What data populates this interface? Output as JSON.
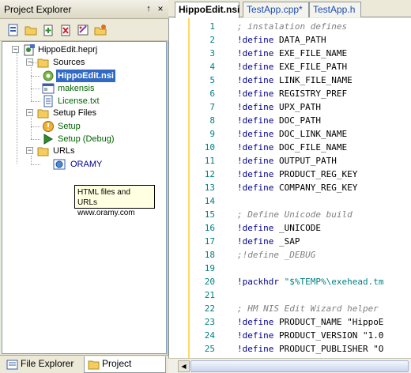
{
  "panel": {
    "title": "Project Explorer",
    "pin_glyph": "↑",
    "close_glyph": "×"
  },
  "toolbar": {
    "buttons": [
      "new-project-icon",
      "open-project-icon",
      "add-file-icon",
      "remove-icon",
      "properties-icon",
      "folder-settings-icon"
    ]
  },
  "tree": {
    "root": "HippoEdit.heprj",
    "sources_label": "Sources",
    "sources": [
      "HippoEdit.nsi",
      "makensis",
      "License.txt"
    ],
    "setup_label": "Setup Files",
    "setup": [
      "Setup",
      "Setup (Debug)"
    ],
    "urls_label": "URLs",
    "urls": [
      "ORAMY"
    ]
  },
  "tooltip": {
    "line1": "HTML files and URLs",
    "line2": "www.oramy.com"
  },
  "bottom_tabs": [
    "File Explorer",
    "Project Explo..."
  ],
  "editor_tabs": [
    "HippoEdit.nsi",
    "TestApp.cpp*",
    "TestApp.h"
  ],
  "code_lines": [
    {
      "n": "1",
      "kw": "",
      "rest": "; instalation defines",
      "style": "cm"
    },
    {
      "n": "2",
      "kw": "!define",
      "rest": " DATA_PATH",
      "style": ""
    },
    {
      "n": "3",
      "kw": "!define",
      "rest": " EXE_FILE_NAME",
      "style": ""
    },
    {
      "n": "4",
      "kw": "!define",
      "rest": " EXE_FILE_PATH",
      "style": ""
    },
    {
      "n": "5",
      "kw": "!define",
      "rest": " LINK_FILE_NAME",
      "style": ""
    },
    {
      "n": "6",
      "kw": "!define",
      "rest": " REGISTRY_PREF",
      "style": ""
    },
    {
      "n": "7",
      "kw": "!define",
      "rest": " UPX_PATH",
      "style": ""
    },
    {
      "n": "8",
      "kw": "!define",
      "rest": " DOC_PATH",
      "style": ""
    },
    {
      "n": "9",
      "kw": "!define",
      "rest": " DOC_LINK_NAME",
      "style": ""
    },
    {
      "n": "10",
      "kw": "!define",
      "rest": " DOC_FILE_NAME",
      "style": ""
    },
    {
      "n": "11",
      "kw": "!define",
      "rest": " OUTPUT_PATH",
      "style": ""
    },
    {
      "n": "12",
      "kw": "!define",
      "rest": " PRODUCT_REG_KEY",
      "style": ""
    },
    {
      "n": "13",
      "kw": "!define",
      "rest": " COMPANY_REG_KEY",
      "style": ""
    },
    {
      "n": "14",
      "kw": "",
      "rest": "",
      "style": ""
    },
    {
      "n": "15",
      "kw": "",
      "rest": "; Define Unicode build",
      "style": "cm"
    },
    {
      "n": "16",
      "kw": "!define",
      "rest": " _UNICODE",
      "style": ""
    },
    {
      "n": "17",
      "kw": "!define",
      "rest": " _SAP",
      "style": ""
    },
    {
      "n": "18",
      "kw": "",
      "rest": ";!define _DEBUG",
      "style": "cm"
    },
    {
      "n": "19",
      "kw": "",
      "rest": "",
      "style": ""
    },
    {
      "n": "20",
      "kw": "!packhdr",
      "rest": " \"$%TEMP%\\exehead.tm",
      "style": "str"
    },
    {
      "n": "21",
      "kw": "",
      "rest": "",
      "style": ""
    },
    {
      "n": "22",
      "kw": "",
      "rest": "; HM NIS Edit Wizard helper",
      "style": "cm"
    },
    {
      "n": "23",
      "kw": "!define",
      "rest": " PRODUCT_NAME \"HippoE",
      "style": "mix"
    },
    {
      "n": "24",
      "kw": "!define",
      "rest": " PRODUCT_VERSION \"1.0",
      "style": "mix"
    },
    {
      "n": "25",
      "kw": "!define",
      "rest": " PRODUCT_PUBLISHER \"O",
      "style": "mix"
    }
  ],
  "colors": {
    "selection": "#316ac5",
    "keyword": "#00008b",
    "comment": "#808080",
    "line_number": "#008080",
    "marker_bar": "#ffd966"
  }
}
